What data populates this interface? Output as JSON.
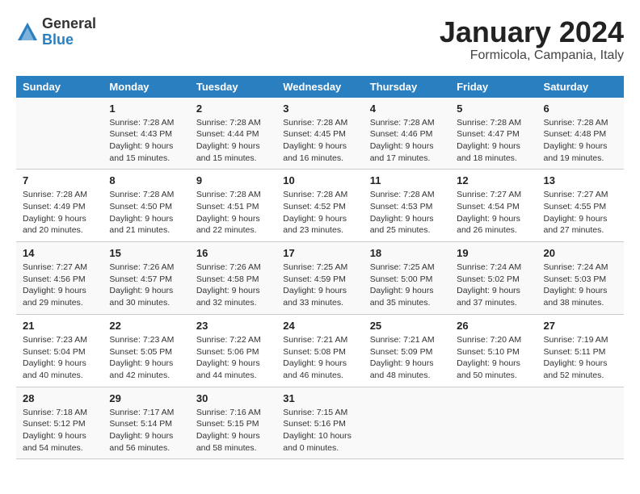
{
  "logo": {
    "general": "General",
    "blue": "Blue"
  },
  "title": "January 2024",
  "location": "Formicola, Campania, Italy",
  "columns": [
    "Sunday",
    "Monday",
    "Tuesday",
    "Wednesday",
    "Thursday",
    "Friday",
    "Saturday"
  ],
  "weeks": [
    [
      {
        "day": "",
        "sunrise": "",
        "sunset": "",
        "daylight": ""
      },
      {
        "day": "1",
        "sunrise": "Sunrise: 7:28 AM",
        "sunset": "Sunset: 4:43 PM",
        "daylight": "Daylight: 9 hours and 15 minutes."
      },
      {
        "day": "2",
        "sunrise": "Sunrise: 7:28 AM",
        "sunset": "Sunset: 4:44 PM",
        "daylight": "Daylight: 9 hours and 15 minutes."
      },
      {
        "day": "3",
        "sunrise": "Sunrise: 7:28 AM",
        "sunset": "Sunset: 4:45 PM",
        "daylight": "Daylight: 9 hours and 16 minutes."
      },
      {
        "day": "4",
        "sunrise": "Sunrise: 7:28 AM",
        "sunset": "Sunset: 4:46 PM",
        "daylight": "Daylight: 9 hours and 17 minutes."
      },
      {
        "day": "5",
        "sunrise": "Sunrise: 7:28 AM",
        "sunset": "Sunset: 4:47 PM",
        "daylight": "Daylight: 9 hours and 18 minutes."
      },
      {
        "day": "6",
        "sunrise": "Sunrise: 7:28 AM",
        "sunset": "Sunset: 4:48 PM",
        "daylight": "Daylight: 9 hours and 19 minutes."
      }
    ],
    [
      {
        "day": "7",
        "sunrise": "Sunrise: 7:28 AM",
        "sunset": "Sunset: 4:49 PM",
        "daylight": "Daylight: 9 hours and 20 minutes."
      },
      {
        "day": "8",
        "sunrise": "Sunrise: 7:28 AM",
        "sunset": "Sunset: 4:50 PM",
        "daylight": "Daylight: 9 hours and 21 minutes."
      },
      {
        "day": "9",
        "sunrise": "Sunrise: 7:28 AM",
        "sunset": "Sunset: 4:51 PM",
        "daylight": "Daylight: 9 hours and 22 minutes."
      },
      {
        "day": "10",
        "sunrise": "Sunrise: 7:28 AM",
        "sunset": "Sunset: 4:52 PM",
        "daylight": "Daylight: 9 hours and 23 minutes."
      },
      {
        "day": "11",
        "sunrise": "Sunrise: 7:28 AM",
        "sunset": "Sunset: 4:53 PM",
        "daylight": "Daylight: 9 hours and 25 minutes."
      },
      {
        "day": "12",
        "sunrise": "Sunrise: 7:27 AM",
        "sunset": "Sunset: 4:54 PM",
        "daylight": "Daylight: 9 hours and 26 minutes."
      },
      {
        "day": "13",
        "sunrise": "Sunrise: 7:27 AM",
        "sunset": "Sunset: 4:55 PM",
        "daylight": "Daylight: 9 hours and 27 minutes."
      }
    ],
    [
      {
        "day": "14",
        "sunrise": "Sunrise: 7:27 AM",
        "sunset": "Sunset: 4:56 PM",
        "daylight": "Daylight: 9 hours and 29 minutes."
      },
      {
        "day": "15",
        "sunrise": "Sunrise: 7:26 AM",
        "sunset": "Sunset: 4:57 PM",
        "daylight": "Daylight: 9 hours and 30 minutes."
      },
      {
        "day": "16",
        "sunrise": "Sunrise: 7:26 AM",
        "sunset": "Sunset: 4:58 PM",
        "daylight": "Daylight: 9 hours and 32 minutes."
      },
      {
        "day": "17",
        "sunrise": "Sunrise: 7:25 AM",
        "sunset": "Sunset: 4:59 PM",
        "daylight": "Daylight: 9 hours and 33 minutes."
      },
      {
        "day": "18",
        "sunrise": "Sunrise: 7:25 AM",
        "sunset": "Sunset: 5:00 PM",
        "daylight": "Daylight: 9 hours and 35 minutes."
      },
      {
        "day": "19",
        "sunrise": "Sunrise: 7:24 AM",
        "sunset": "Sunset: 5:02 PM",
        "daylight": "Daylight: 9 hours and 37 minutes."
      },
      {
        "day": "20",
        "sunrise": "Sunrise: 7:24 AM",
        "sunset": "Sunset: 5:03 PM",
        "daylight": "Daylight: 9 hours and 38 minutes."
      }
    ],
    [
      {
        "day": "21",
        "sunrise": "Sunrise: 7:23 AM",
        "sunset": "Sunset: 5:04 PM",
        "daylight": "Daylight: 9 hours and 40 minutes."
      },
      {
        "day": "22",
        "sunrise": "Sunrise: 7:23 AM",
        "sunset": "Sunset: 5:05 PM",
        "daylight": "Daylight: 9 hours and 42 minutes."
      },
      {
        "day": "23",
        "sunrise": "Sunrise: 7:22 AM",
        "sunset": "Sunset: 5:06 PM",
        "daylight": "Daylight: 9 hours and 44 minutes."
      },
      {
        "day": "24",
        "sunrise": "Sunrise: 7:21 AM",
        "sunset": "Sunset: 5:08 PM",
        "daylight": "Daylight: 9 hours and 46 minutes."
      },
      {
        "day": "25",
        "sunrise": "Sunrise: 7:21 AM",
        "sunset": "Sunset: 5:09 PM",
        "daylight": "Daylight: 9 hours and 48 minutes."
      },
      {
        "day": "26",
        "sunrise": "Sunrise: 7:20 AM",
        "sunset": "Sunset: 5:10 PM",
        "daylight": "Daylight: 9 hours and 50 minutes."
      },
      {
        "day": "27",
        "sunrise": "Sunrise: 7:19 AM",
        "sunset": "Sunset: 5:11 PM",
        "daylight": "Daylight: 9 hours and 52 minutes."
      }
    ],
    [
      {
        "day": "28",
        "sunrise": "Sunrise: 7:18 AM",
        "sunset": "Sunset: 5:12 PM",
        "daylight": "Daylight: 9 hours and 54 minutes."
      },
      {
        "day": "29",
        "sunrise": "Sunrise: 7:17 AM",
        "sunset": "Sunset: 5:14 PM",
        "daylight": "Daylight: 9 hours and 56 minutes."
      },
      {
        "day": "30",
        "sunrise": "Sunrise: 7:16 AM",
        "sunset": "Sunset: 5:15 PM",
        "daylight": "Daylight: 9 hours and 58 minutes."
      },
      {
        "day": "31",
        "sunrise": "Sunrise: 7:15 AM",
        "sunset": "Sunset: 5:16 PM",
        "daylight": "Daylight: 10 hours and 0 minutes."
      },
      {
        "day": "",
        "sunrise": "",
        "sunset": "",
        "daylight": ""
      },
      {
        "day": "",
        "sunrise": "",
        "sunset": "",
        "daylight": ""
      },
      {
        "day": "",
        "sunrise": "",
        "sunset": "",
        "daylight": ""
      }
    ]
  ]
}
